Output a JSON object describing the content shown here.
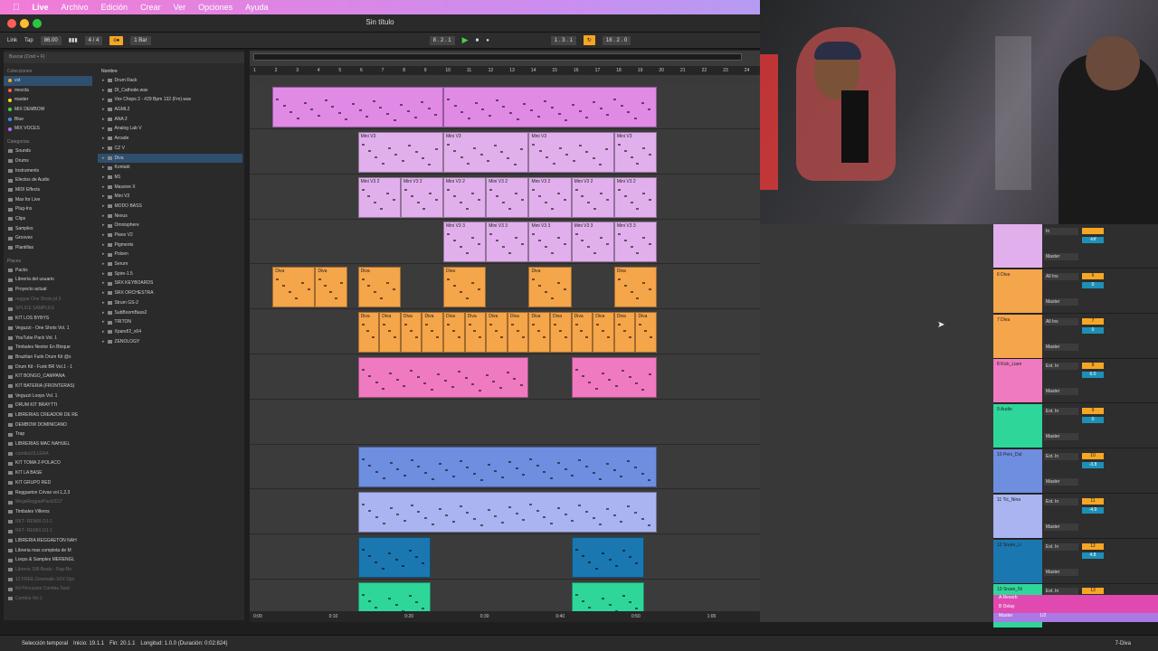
{
  "menubar": {
    "apple_icon": "apple-icon",
    "app": "Live",
    "items": [
      "Archivo",
      "Edición",
      "Crear",
      "Ver",
      "Opciones",
      "Ayuda"
    ]
  },
  "window": {
    "title": "Sin título"
  },
  "transport": {
    "link": "Link",
    "tap": "Tap",
    "tempo": "86.00",
    "time_sig": "4 / 4",
    "quantize": "1 Bar",
    "position": "8 . 2 . 1",
    "loop_start": "1 . 3 . 1",
    "loop_len": "18 . 2 . 0"
  },
  "browser": {
    "search_placeholder": "Buscar (Cmd + F)",
    "sections": {
      "collections": "Colecciones",
      "categories": "Categorías",
      "places": "Places"
    },
    "collections": [
      {
        "label": "vst",
        "color": "#f5a623",
        "selected": true
      },
      {
        "label": "mezcla",
        "color": "#ff5a5a"
      },
      {
        "label": "master",
        "color": "#f5d623"
      },
      {
        "label": "MIX DEMBOW",
        "color": "#47d147"
      },
      {
        "label": "Blue",
        "color": "#3b8cff"
      },
      {
        "label": "MIX VOCES",
        "color": "#b36bff"
      }
    ],
    "categories": [
      "Sounds",
      "Drums",
      "Instruments",
      "Efectos de Audio",
      "MIDI Effects",
      "Max for Live",
      "Plug-Ins",
      "Clips",
      "Samples",
      "Grooves",
      "Plantillas"
    ],
    "places": [
      {
        "label": "Packs"
      },
      {
        "label": "Librería del usuario"
      },
      {
        "label": "Proyecto actual"
      },
      {
        "label": "reggae One Shots pt 3",
        "dim": true
      },
      {
        "label": "SPLICE SAMPLES",
        "dim": true
      },
      {
        "label": "KIT LOS BYBYS"
      },
      {
        "label": "Veguzzi - One Shots Vol. 1"
      },
      {
        "label": "YouTube Pack Vol. 1"
      },
      {
        "label": "Timbales Nestor En Bloque"
      },
      {
        "label": "Brazilian Funk Drum Kit @s"
      },
      {
        "label": "Drum Kit - Funk BR Vol.1 - 1"
      },
      {
        "label": "KIT BONGO_CAMPANA"
      },
      {
        "label": "KIT BATERIA (FRONTERAS)"
      },
      {
        "label": "Veguzzi Loops Vol. 1"
      },
      {
        "label": "DRUM KIT BRAYTTI"
      },
      {
        "label": "LIBRERIAS CREADOR DE RE"
      },
      {
        "label": "DEMBOW DOMINICANO"
      },
      {
        "label": "Trap"
      },
      {
        "label": "LIBRERIAS MAC NAHUEL"
      },
      {
        "label": "cumbiaVILLERA",
        "dim": true
      },
      {
        "label": "KIT TOMA 2-POLACO"
      },
      {
        "label": "KIT LA BASE"
      },
      {
        "label": "KIT GRUPO RED"
      },
      {
        "label": "Reggaeton Crivas vol.1,2,3"
      },
      {
        "label": "MegaReggaePack2017",
        "dim": true
      },
      {
        "label": "Timbales Villeros"
      },
      {
        "label": "RKT- REMIX-DJ-1",
        "dim": true
      },
      {
        "label": "RKT- REMIX-DJ-1",
        "dim": true
      },
      {
        "label": "LIBRERIA REGGAETON NAH"
      },
      {
        "label": "Libreria mas completa de M"
      },
      {
        "label": "Loops & Samples MERENGL"
      },
      {
        "label": "Libreria 188 Beats - Rap-Bo",
        "dim": true
      },
      {
        "label": "12 FREE Cinematic SFX Opc",
        "dim": true
      },
      {
        "label": "Kit Percusion Cumbia Sant",
        "dim": true
      },
      {
        "label": "Cumbia Vol 1",
        "dim": true
      }
    ],
    "name_header": "Nombre",
    "names": [
      {
        "label": "Drum Rack"
      },
      {
        "label": "DI_Cathode.wav"
      },
      {
        "label": "Vox Chops 2 - #29 Bpm 132 (Fm).wav"
      },
      {
        "label": "AGML2"
      },
      {
        "label": "ANA 2"
      },
      {
        "label": "Analog Lab V"
      },
      {
        "label": "Arcade"
      },
      {
        "label": "CZ V"
      },
      {
        "label": "Diva",
        "selected": true
      },
      {
        "label": "Kontakt"
      },
      {
        "label": "M1"
      },
      {
        "label": "Massive X"
      },
      {
        "label": "Mini V3"
      },
      {
        "label": "MODO BASS"
      },
      {
        "label": "Nexus"
      },
      {
        "label": "Omnisphere"
      },
      {
        "label": "Piano V2"
      },
      {
        "label": "Pigments"
      },
      {
        "label": "Polzen"
      },
      {
        "label": "Serum"
      },
      {
        "label": "Spire-1.5"
      },
      {
        "label": "SRX KEYBOARDS"
      },
      {
        "label": "SRX ORCHESTRA"
      },
      {
        "label": "Strum GS-2"
      },
      {
        "label": "SubBoomBass2"
      },
      {
        "label": "TRITON"
      },
      {
        "label": "Xpand!2_x64"
      },
      {
        "label": "ZENOLOGY"
      }
    ]
  },
  "ruler": {
    "bars": [
      "1",
      "2",
      "3",
      "4",
      "5",
      "6",
      "7",
      "8",
      "9",
      "10",
      "11",
      "12",
      "13",
      "14",
      "15",
      "16",
      "17",
      "18",
      "19",
      "20",
      "21",
      "22",
      "23",
      "24"
    ]
  },
  "timeline": {
    "marks": [
      "0:00",
      "0:10",
      "0:20",
      "0:30",
      "0:40",
      "0:50",
      "1:00",
      "1:10",
      "1:20",
      "1:30"
    ]
  },
  "tracks": [
    {
      "color": "#e08ae6",
      "clips": [
        {
          "label": "",
          "start": 1,
          "len": 8
        },
        {
          "label": "",
          "start": 9,
          "len": 10
        }
      ]
    },
    {
      "color": "#e1b0ec",
      "clips": [
        {
          "label": "Mini V3",
          "start": 5,
          "len": 4
        },
        {
          "label": "Mini V3",
          "start": 9,
          "len": 4
        },
        {
          "label": "Mini V3",
          "start": 13,
          "len": 4
        },
        {
          "label": "Mini V3",
          "start": 17,
          "len": 2
        }
      ]
    },
    {
      "color": "#e1b0ec",
      "clips": [
        {
          "label": "Mini V3 2",
          "start": 5,
          "len": 2
        },
        {
          "label": "Mini V3 2",
          "start": 7,
          "len": 2
        },
        {
          "label": "Mini V3 2",
          "start": 9,
          "len": 2
        },
        {
          "label": "Mini V3 2",
          "start": 11,
          "len": 2
        },
        {
          "label": "Mini V3 2",
          "start": 13,
          "len": 2
        },
        {
          "label": "Mini V3 2",
          "start": 15,
          "len": 2
        },
        {
          "label": "Mini V3 2",
          "start": 17,
          "len": 2
        }
      ]
    },
    {
      "color": "#e1b0ec",
      "clips": [
        {
          "label": "Mini V3 3",
          "start": 9,
          "len": 2
        },
        {
          "label": "Mini V3 3",
          "start": 11,
          "len": 2
        },
        {
          "label": "Mini V3 3",
          "start": 13,
          "len": 2
        },
        {
          "label": "Mini V3 3",
          "start": 15,
          "len": 2
        },
        {
          "label": "Mini V3 3",
          "start": 17,
          "len": 2
        }
      ]
    },
    {
      "color": "#f5a54a",
      "clips": [
        {
          "label": "Diva",
          "start": 1,
          "len": 2
        },
        {
          "label": "Diva",
          "start": 3,
          "len": 1.5
        },
        {
          "label": "Diva",
          "start": 5,
          "len": 2
        },
        {
          "label": "Diva",
          "start": 9,
          "len": 2
        },
        {
          "label": "Diva",
          "start": 13,
          "len": 2
        },
        {
          "label": "Diva",
          "start": 17,
          "len": 2
        }
      ]
    },
    {
      "color": "#f5a54a",
      "clips": [
        {
          "label": "Diva",
          "start": 5,
          "len": 1
        },
        {
          "label": "Diva",
          "start": 6,
          "len": 1
        },
        {
          "label": "Diva",
          "start": 7,
          "len": 1
        },
        {
          "label": "Diva",
          "start": 8,
          "len": 1
        },
        {
          "label": "Diva",
          "start": 9,
          "len": 1
        },
        {
          "label": "Diva",
          "start": 10,
          "len": 1
        },
        {
          "label": "Diva",
          "start": 11,
          "len": 1
        },
        {
          "label": "Diva",
          "start": 12,
          "len": 1
        },
        {
          "label": "Diva",
          "start": 13,
          "len": 1
        },
        {
          "label": "Diva",
          "start": 14,
          "len": 1
        },
        {
          "label": "Diva",
          "start": 15,
          "len": 1
        },
        {
          "label": "Diva",
          "start": 16,
          "len": 1
        },
        {
          "label": "Diva",
          "start": 17,
          "len": 1
        },
        {
          "label": "Diva",
          "start": 18,
          "len": 1
        }
      ]
    },
    {
      "color": "#f07ac0",
      "clips": [
        {
          "label": "",
          "start": 5,
          "len": 8
        },
        {
          "label": "",
          "start": 15,
          "len": 4
        }
      ]
    },
    {
      "color": "#3b3b3b",
      "clips": []
    },
    {
      "color": "#6e8ee0",
      "clips": [
        {
          "label": "",
          "start": 5,
          "len": 14
        }
      ]
    },
    {
      "color": "#a9b4f0",
      "clips": [
        {
          "label": "",
          "start": 5,
          "len": 14
        }
      ]
    },
    {
      "color": "#1b77b0",
      "clips": [
        {
          "label": "",
          "start": 5,
          "len": 3.4
        },
        {
          "label": "",
          "start": 15,
          "len": 3.4
        }
      ]
    },
    {
      "color": "#2fd699",
      "clips": [
        {
          "label": "",
          "start": 5,
          "len": 3.4
        },
        {
          "label": "",
          "start": 15,
          "len": 3.4
        }
      ]
    }
  ],
  "mixer": {
    "tracks": [
      {
        "name": "",
        "color": "#e1b0ec",
        "input": "In",
        "route": "Master",
        "num": "",
        "vol": "-inf"
      },
      {
        "name": "6 Diva",
        "color": "#f5a54a",
        "input": "All Ins",
        "route": "Master",
        "num": "6",
        "vol": "0"
      },
      {
        "name": "7 Diva",
        "color": "#f5a54a",
        "input": "All Ins",
        "route": "Master",
        "num": "7",
        "vol": "0"
      },
      {
        "name": "8 Kick_Liam",
        "color": "#f07ac0",
        "input": "Ext. In",
        "route": "Master",
        "num": "8",
        "vol": "6.0"
      },
      {
        "name": "9 Audio",
        "color": "#2fd699",
        "input": "Ext. In",
        "route": "Master",
        "num": "9",
        "vol": "0"
      },
      {
        "name": "10 Perc_Dul",
        "color": "#6e8ee0",
        "input": "Ext. In",
        "route": "Master",
        "num": "10",
        "vol": "-3.8"
      },
      {
        "name": "11 Tic_Nina",
        "color": "#a9b4f0",
        "input": "Ext. In",
        "route": "Master",
        "num": "11",
        "vol": "-4.9"
      },
      {
        "name": "12 Snare_Li",
        "color": "#1b77b0",
        "input": "Ext. In",
        "route": "Master",
        "num": "12",
        "vol": "4.8"
      },
      {
        "name": "13 Snare_Ni",
        "color": "#2fd699",
        "input": "Ext. In",
        "route": "Master",
        "num": "13",
        "vol": "6.0"
      }
    ],
    "returns": [
      {
        "name": "A Reverb",
        "color": "#e04ab0"
      },
      {
        "name": "B Delay",
        "color": "#e04ab0"
      },
      {
        "name": "Master",
        "color": "#a97ae6",
        "extra": "1/2"
      }
    ]
  },
  "status": {
    "mode": "Selección temporal",
    "start": "Inicio: 19.1.1",
    "end": "Fin: 20.1.1",
    "length": "Longitud: 1.0.0 (Duración: 0:02:824)",
    "track": "7-Diva"
  }
}
